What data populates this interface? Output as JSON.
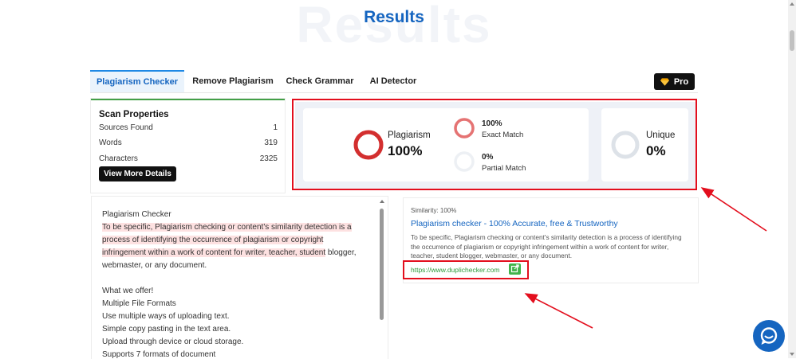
{
  "page": {
    "title": "Results",
    "ghost_title": "Results"
  },
  "tabs": [
    {
      "label": "Plagiarism Checker",
      "active": true
    },
    {
      "label": "Remove Plagiarism",
      "active": false
    },
    {
      "label": "Check Grammar",
      "active": false
    },
    {
      "label": "AI Detector",
      "active": false
    }
  ],
  "pro": {
    "label": "Pro",
    "icon": "diamond-icon"
  },
  "scan": {
    "title": "Scan Properties",
    "rows": [
      {
        "label": "Sources Found",
        "value": "1"
      },
      {
        "label": "Words",
        "value": "319"
      },
      {
        "label": "Characters",
        "value": "2325"
      }
    ],
    "button": "View More Details"
  },
  "results": {
    "plagiarism": {
      "label": "Plagiarism",
      "value": "100%",
      "fraction": 1.0,
      "color": "#d32f2f"
    },
    "exact": {
      "value": "100%",
      "label": "Exact Match",
      "fraction": 1.0,
      "color": "#e57373"
    },
    "partial": {
      "value": "0%",
      "label": "Partial Match",
      "fraction": 0.0
    },
    "unique": {
      "label": "Unique",
      "value": "0%",
      "fraction": 0.0
    }
  },
  "text_panel": {
    "lines": [
      {
        "text": "Plagiarism Checker",
        "highlight": false
      },
      {
        "text": "To be specific, Plagiarism checking or content's similarity detection is a",
        "highlight": true
      },
      {
        "text": "process of identifying the occurrence of plagiarism or copyright",
        "highlight": true
      },
      {
        "text": "infringement within a work of content for writer, teacher, student",
        "highlight": true,
        "tail": " blogger,"
      },
      {
        "text": "webmaster, or any document.",
        "highlight": false
      },
      {
        "text": "",
        "highlight": false
      },
      {
        "text": "What we offer!",
        "highlight": false
      },
      {
        "text": " Multiple File Formats",
        "highlight": false
      },
      {
        "text": "Use multiple ways of uploading text.",
        "highlight": false
      },
      {
        "text": "Simple copy pasting in the text area.",
        "highlight": false
      },
      {
        "text": "Upload through device or cloud storage.",
        "highlight": false
      },
      {
        "text": "Supports 7 formats of document",
        "highlight": false
      }
    ]
  },
  "source": {
    "similarity": "Similarity: 100%",
    "title": "Plagiarism checker - 100% Accurate, free & Trustworthy",
    "description": "To be specific, Plagiarism checking or content's similarity detection is a process of identifying the occurrence of plagiarism or copyright infringement within a work of content for writer, teacher, student blogger, webmaster, or any document.",
    "url": "https://www.duplichecker.com"
  },
  "colors": {
    "accent_blue": "#1565c0",
    "annotation_red": "#e30e1d",
    "url_green": "#2e9b3c"
  }
}
